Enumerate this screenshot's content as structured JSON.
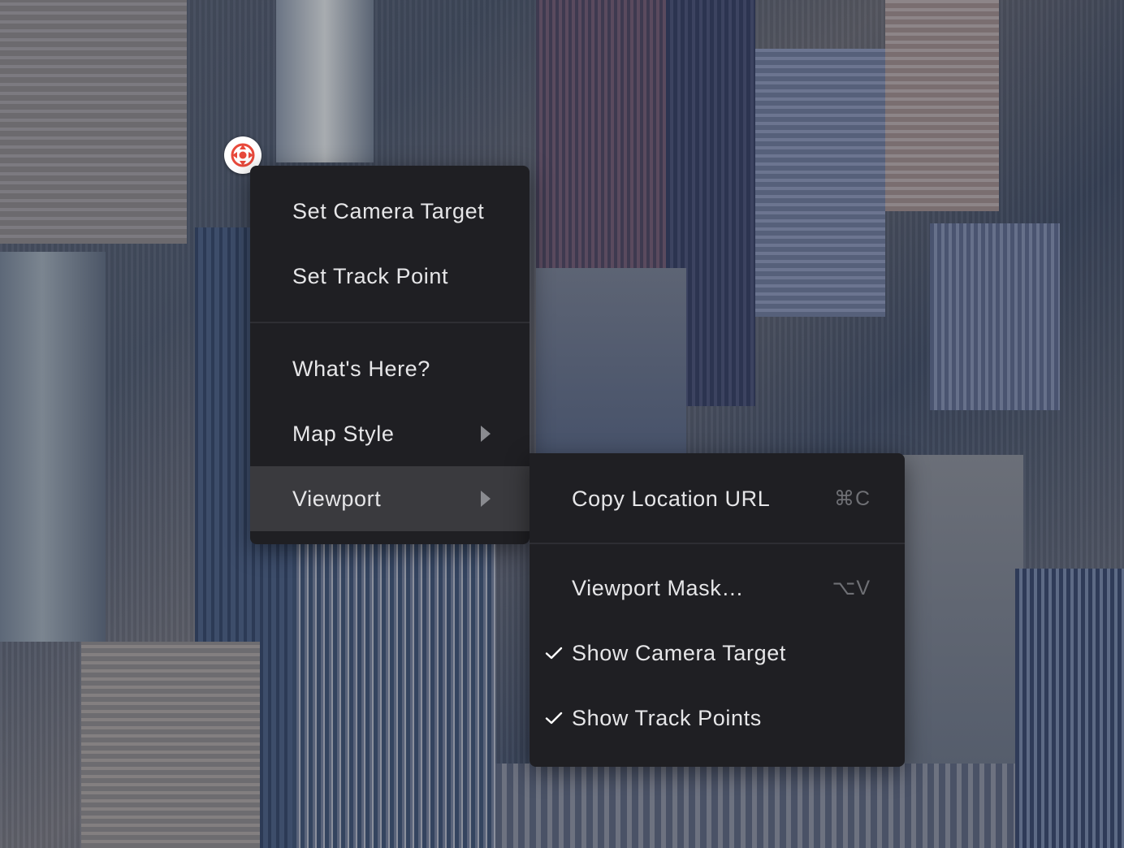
{
  "map": {
    "view": "3D aerial satellite view of city buildings"
  },
  "marker": {
    "icon": "camera-target-icon",
    "color": "#e8493b"
  },
  "context_menu": {
    "items": [
      {
        "label": "Set Camera Target"
      },
      {
        "label": "Set Track Point"
      },
      {
        "label": "What's Here?"
      },
      {
        "label": "Map Style",
        "has_submenu": true
      },
      {
        "label": "Viewport",
        "has_submenu": true,
        "active": true
      }
    ]
  },
  "viewport_submenu": {
    "items": [
      {
        "label": "Copy Location URL",
        "shortcut": "⌘C"
      },
      {
        "label": "Viewport Mask…",
        "shortcut": "⌥V"
      },
      {
        "label": "Show Camera Target",
        "checked": true,
        "check_icon": "✓"
      },
      {
        "label": "Show Track Points",
        "checked": true,
        "check_icon": "✓"
      }
    ]
  },
  "colors": {
    "menu_bg": "#1f1f23",
    "menu_active_bg": "#3a3a3e",
    "menu_text": "#e6e6e8",
    "shortcut_text": "#6f7075",
    "marker_accent": "#e8493b"
  }
}
